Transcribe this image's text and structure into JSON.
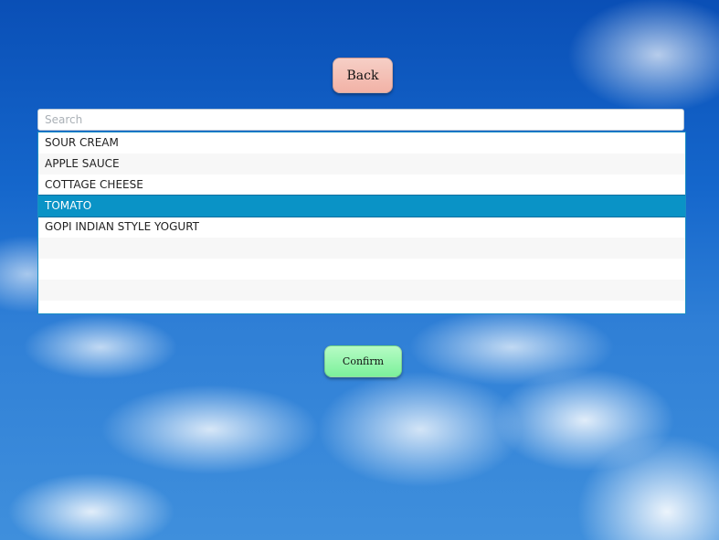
{
  "back_button": {
    "label": "Back"
  },
  "search": {
    "placeholder": "Search",
    "value": ""
  },
  "list": {
    "items": [
      {
        "label": "SOUR CREAM",
        "selected": false
      },
      {
        "label": "APPLE SAUCE",
        "selected": false
      },
      {
        "label": "COTTAGE CHEESE",
        "selected": false
      },
      {
        "label": "TOMATO",
        "selected": true
      },
      {
        "label": "GOPI INDIAN STYLE YOGURT",
        "selected": false
      }
    ]
  },
  "confirm_button": {
    "label": "Confirm"
  },
  "colors": {
    "back_button": "#f2b2a6",
    "confirm_button": "#7cf19b",
    "selection": "#0a93c6",
    "list_border": "#1a8fc4"
  }
}
